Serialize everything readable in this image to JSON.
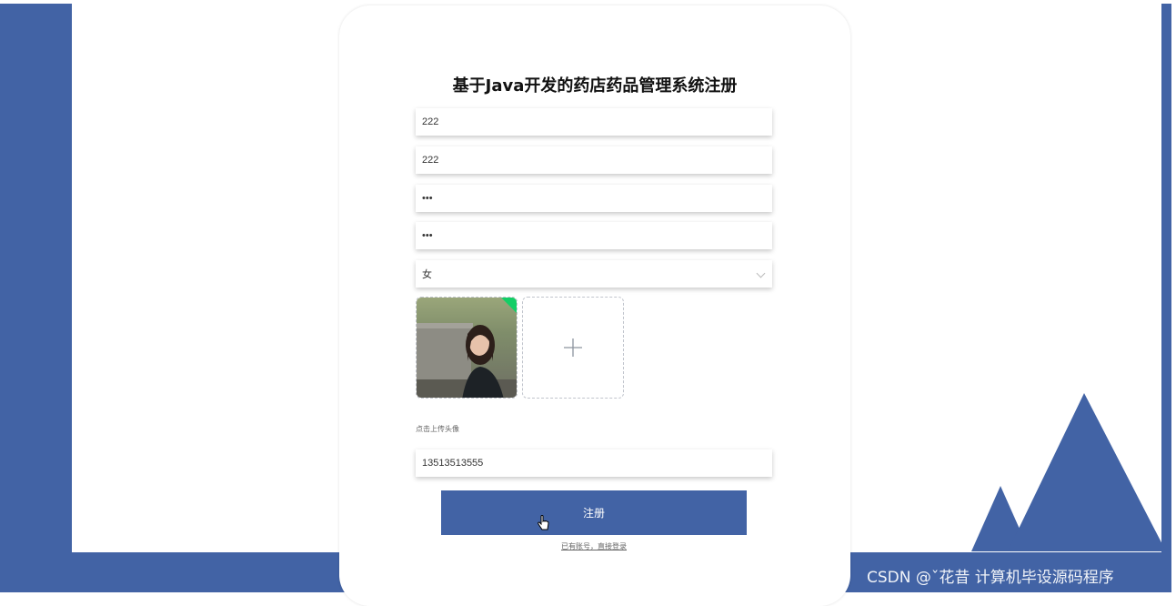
{
  "register": {
    "title": "基于Java开发的药店药品管理系统注册",
    "username_value": "222",
    "name_value": "222",
    "password_value": "•••",
    "confirm_password_value": "•••",
    "gender_value": "女",
    "upload_hint": "点击上传头像",
    "phone_value": "13513513555",
    "submit_label": "注册",
    "login_link": "已有账号，直接登录"
  },
  "watermark": "CSDN @ˇ花昔  计算机毕设源码程序",
  "icons": {
    "select_arrow": "chevron-down-icon",
    "upload": "plus-icon",
    "upload_success": "success-corner-icon",
    "cursor": "hand-pointer-icon"
  },
  "colors": {
    "primary": "#4263a5",
    "success": "#13ce66",
    "background": "#ffffff"
  }
}
